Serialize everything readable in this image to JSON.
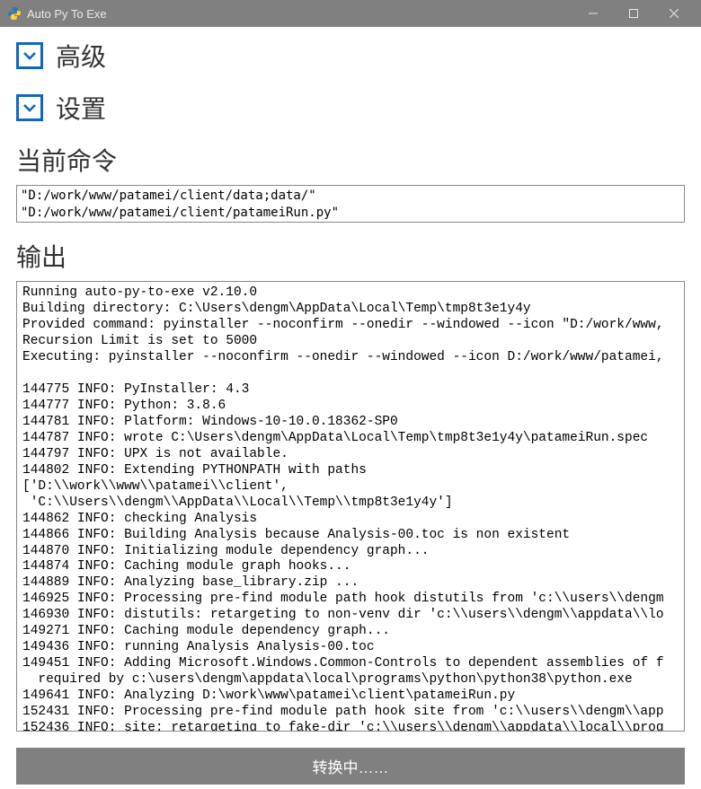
{
  "window": {
    "title": "Auto Py To Exe"
  },
  "sections": {
    "advanced": "高级",
    "settings": "设置",
    "current_command": "当前命令",
    "output": "输出"
  },
  "command_text": "\"D:/work/www/patamei/client/data;data/\"\n\"D:/work/www/patamei/client/patameiRun.py\"",
  "output_text": "Running auto-py-to-exe v2.10.0\nBuilding directory: C:\\Users\\dengm\\AppData\\Local\\Temp\\tmp8t3e1y4y\nProvided command: pyinstaller --noconfirm --onedir --windowed --icon \"D:/work/www,\nRecursion Limit is set to 5000\nExecuting: pyinstaller --noconfirm --onedir --windowed --icon D:/work/www/patamei,\n\n144775 INFO: PyInstaller: 4.3\n144777 INFO: Python: 3.8.6\n144781 INFO: Platform: Windows-10-10.0.18362-SP0\n144787 INFO: wrote C:\\Users\\dengm\\AppData\\Local\\Temp\\tmp8t3e1y4y\\patameiRun.spec\n144797 INFO: UPX is not available.\n144802 INFO: Extending PYTHONPATH with paths\n['D:\\\\work\\\\www\\\\patamei\\\\client',\n 'C:\\\\Users\\\\dengm\\\\AppData\\\\Local\\\\Temp\\\\tmp8t3e1y4y']\n144862 INFO: checking Analysis\n144866 INFO: Building Analysis because Analysis-00.toc is non existent\n144870 INFO: Initializing module dependency graph...\n144874 INFO: Caching module graph hooks...\n144889 INFO: Analyzing base_library.zip ...\n146925 INFO: Processing pre-find module path hook distutils from 'c:\\\\users\\\\dengm\n146930 INFO: distutils: retargeting to non-venv dir 'c:\\\\users\\\\dengm\\\\appdata\\\\lo\n149271 INFO: Caching module dependency graph...\n149436 INFO: running Analysis Analysis-00.toc\n149451 INFO: Adding Microsoft.Windows.Common-Controls to dependent assemblies of f\n  required by c:\\users\\dengm\\appdata\\local\\programs\\python\\python38\\python.exe\n149641 INFO: Analyzing D:\\work\\www\\patamei\\client\\patameiRun.py\n152431 INFO: Processing pre-find module path hook site from 'c:\\\\users\\\\dengm\\\\app\n152436 INFO: site: retargeting to fake-dir 'c:\\\\users\\\\dengm\\\\appdata\\\\local\\\\prog",
  "convert_button": "转换中……"
}
